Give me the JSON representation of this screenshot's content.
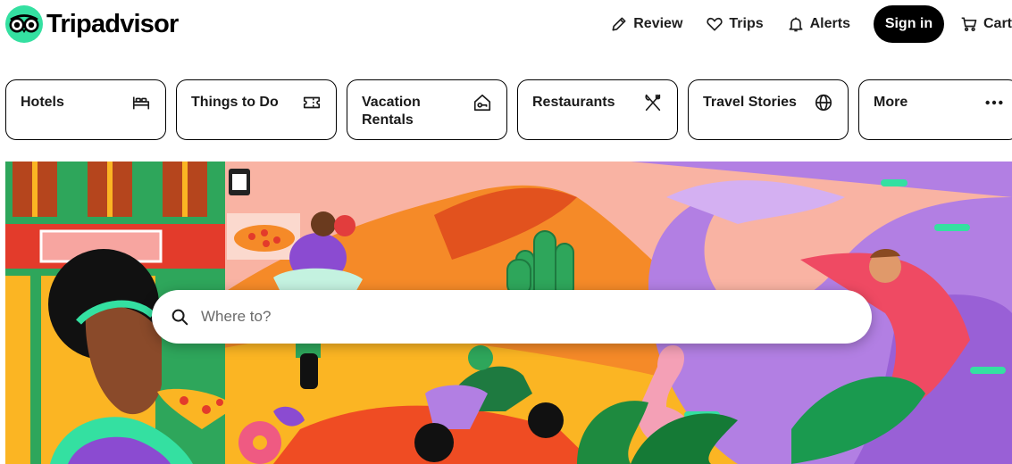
{
  "brand": {
    "name": "Tripadvisor",
    "logo_icon": "owl-eyes-logo-icon",
    "accent": "#34e0a1"
  },
  "header": {
    "review_label": "Review",
    "trips_label": "Trips",
    "alerts_label": "Alerts",
    "signin_label": "Sign in",
    "cart_label": "Cart",
    "icons": {
      "review": "pencil-icon",
      "trips": "heart-icon",
      "alerts": "bell-icon",
      "cart": "cart-icon"
    }
  },
  "tabs": [
    {
      "label": "Hotels",
      "icon": "bed-icon"
    },
    {
      "label": "Things to Do",
      "icon": "ticket-icon"
    },
    {
      "label": "Vacation Rentals",
      "icon": "house-key-icon"
    },
    {
      "label": "Restaurants",
      "icon": "fork-knife-icon"
    },
    {
      "label": "Travel Stories",
      "icon": "globe-icon"
    },
    {
      "label": "More",
      "icon": "more-dots-icon"
    }
  ],
  "hero": {
    "search_placeholder": "Where to?",
    "search_icon": "search-icon"
  }
}
